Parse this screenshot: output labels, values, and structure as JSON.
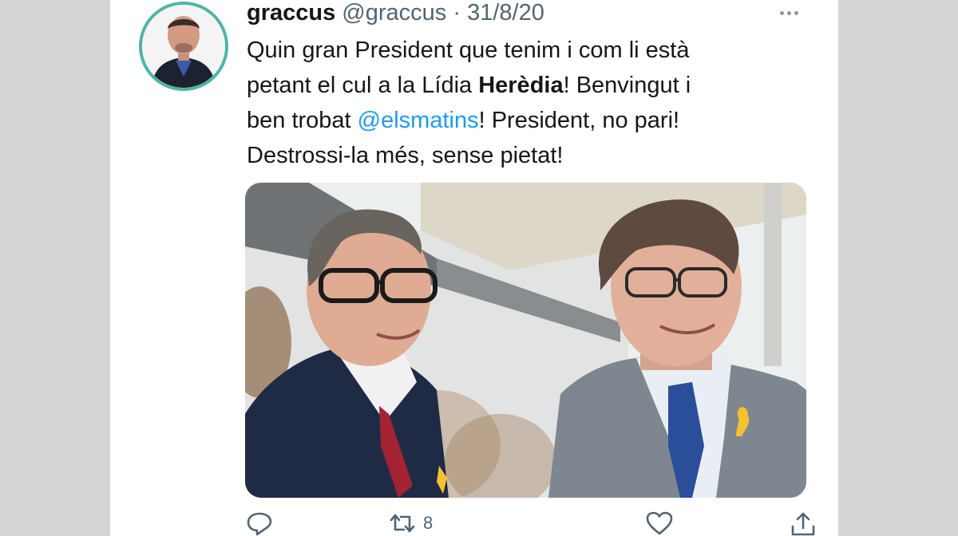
{
  "tweet": {
    "display_name": "graccus",
    "handle": "@graccus",
    "separator": "·",
    "date": "31/8/20",
    "text_parts": {
      "line1": "Quin gran President que tenim i com li està",
      "line2_before": "petant el cul a la Lídia ",
      "line2_bold": "Herèdia",
      "line2_after": "! Benvingut i",
      "line3_before": "ben trobat ",
      "line3_mention": "@elsmatins",
      "line3_after": "! President, no pari!",
      "line4": "Destrossi-la més, sense pietat!"
    }
  },
  "actions": {
    "reply_icon": "reply-icon",
    "retweet_icon": "retweet-icon",
    "retweet_count": "8",
    "like_icon": "heart-icon",
    "share_icon": "share-icon"
  },
  "colors": {
    "avatar_border": "#4fb5a5",
    "mention": "#1d9bf0",
    "secondary_text": "#536471",
    "page_background": "#d5d5d5"
  }
}
